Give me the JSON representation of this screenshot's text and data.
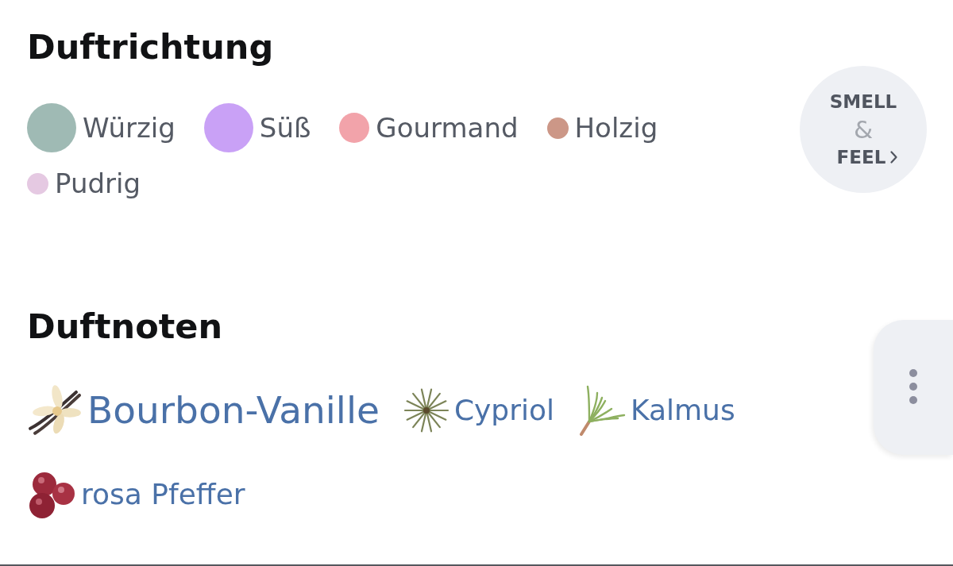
{
  "scent_direction": {
    "title": "Duftrichtung",
    "tags": [
      {
        "label": "Würzig",
        "color": "#9fbab4",
        "kind": "large"
      },
      {
        "label": "Süß",
        "color": "#c9a1f6",
        "kind": "large"
      },
      {
        "label": "Gourmand",
        "color": "#f2a3aa",
        "kind": "medium"
      },
      {
        "label": "Holzig",
        "color": "#cc9787",
        "kind": "small"
      },
      {
        "label": "Pudrig",
        "color": "#e5c9e2",
        "kind": "small"
      }
    ]
  },
  "smell_feel_button": {
    "line_1": "SMELL",
    "line_2": "&",
    "line_3": "FEEL"
  },
  "scent_notes": {
    "title": "Duftnoten",
    "notes": [
      {
        "label": "Bourbon-Vanille",
        "kind": "featured"
      },
      {
        "label": "Cypriol",
        "kind": "regular"
      },
      {
        "label": "Kalmus",
        "kind": "regular"
      },
      {
        "label": "rosa Pfeffer",
        "kind": "regular"
      }
    ]
  }
}
